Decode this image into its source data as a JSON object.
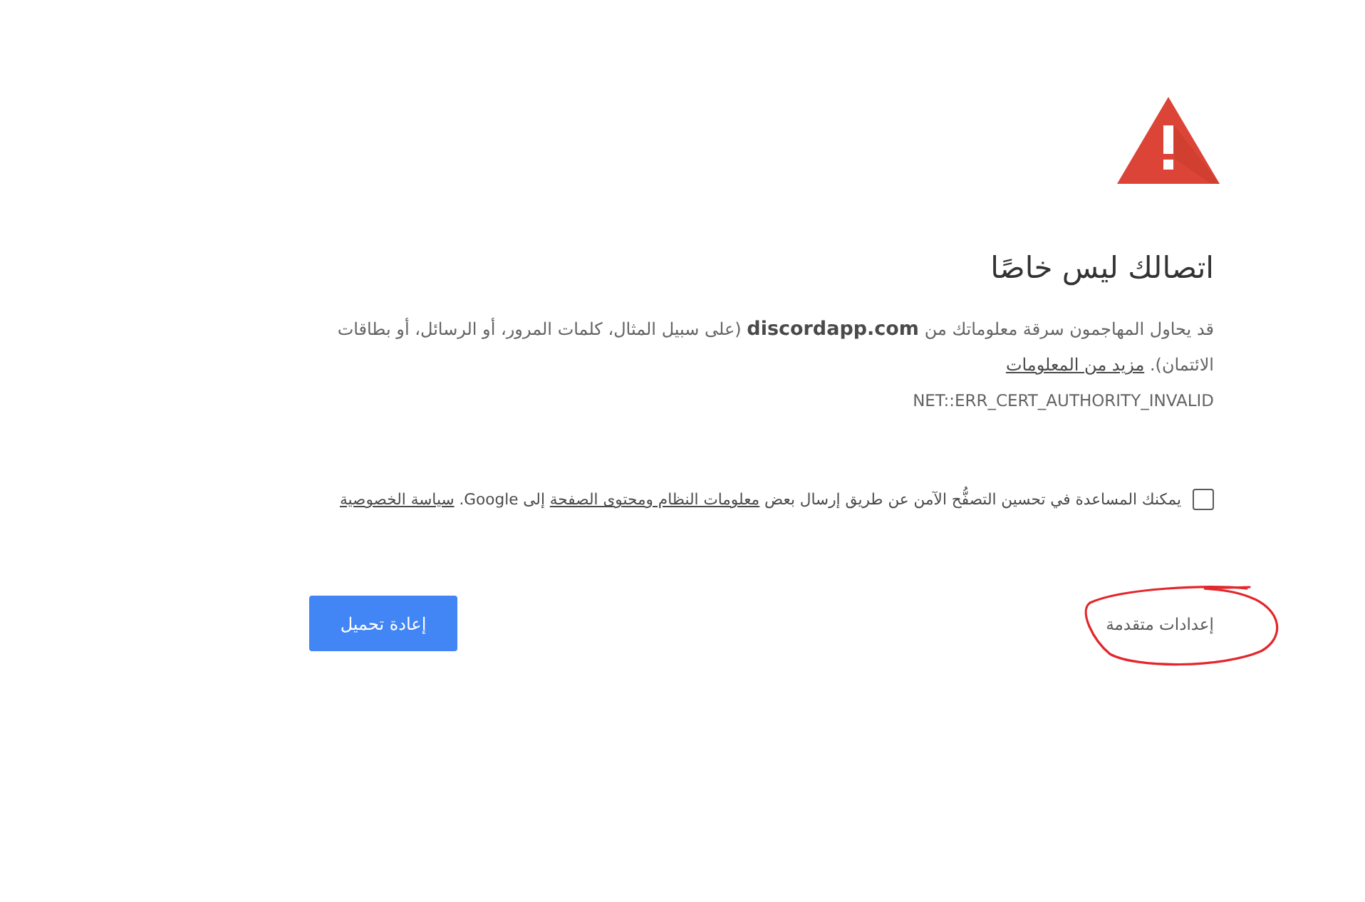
{
  "warning": {
    "title": "اتصالك ليس خاصًا",
    "message": "قد يحاول المهاجمون سرقة معلوماتك من **discordapp.com** (على سبيل المثال، كلمات المرور، أو الرسائل، أو بطاقات الائتمان).",
    "learn_more_link": "مزيد من المعلومات",
    "error_code": "NET::ERR_CERT_AUTHORITY_INVALID"
  },
  "opt_in": {
    "checked": false,
    "parts": [
      {
        "kind": "text",
        "text": "يمكنك المساعدة في تحسين التصفُّح الآمن عن طريق إرسال بعض"
      },
      {
        "kind": "link",
        "text": "معلومات النظام ومحتوى الصفحة"
      },
      {
        "kind": "text",
        "text": "إلى Google."
      },
      {
        "kind": "link",
        "text": "سياسة الخصوصية"
      }
    ]
  },
  "buttons": [
    {
      "kind": "text",
      "label": "إعدادات متقدمة"
    },
    {
      "kind": "primary",
      "label": "إعادة تحميل"
    }
  ]
}
